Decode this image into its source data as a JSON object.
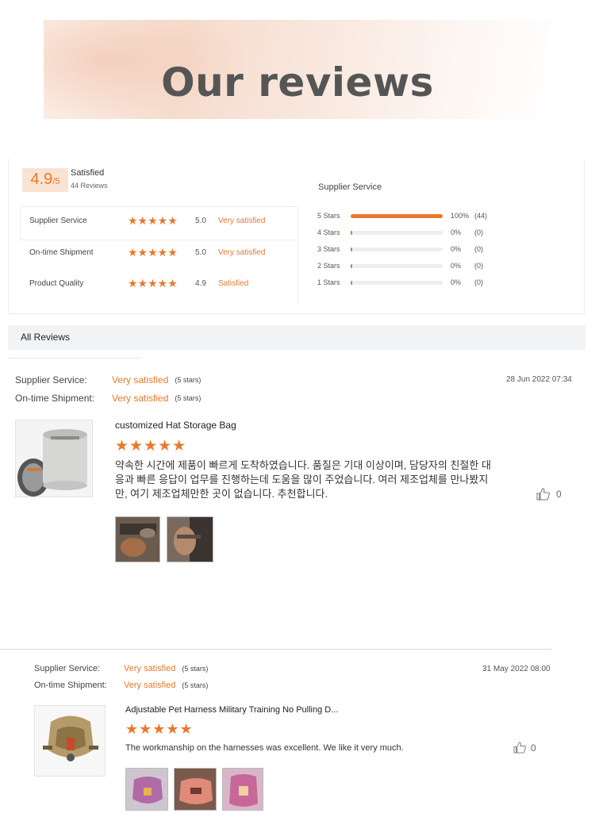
{
  "banner": {
    "title": "Our reviews"
  },
  "summary": {
    "score": "4.9",
    "score_denominator": "/5",
    "label": "Satisfied",
    "review_count": "44 Reviews",
    "ratings": [
      {
        "label": "Supplier Service",
        "stars": 5,
        "stars_text": "★★★★★",
        "value": "5.0",
        "desc": "Very satisfied"
      },
      {
        "label": "On-time Shipment",
        "stars": 5,
        "stars_text": "★★★★★",
        "value": "5.0",
        "desc": "Very satisfied"
      },
      {
        "label": "Product Quality",
        "stars": 5,
        "stars_text": "★★★★★",
        "value": "4.9",
        "desc": "Satisfied"
      }
    ],
    "breakdown_title": "Supplier Service",
    "breakdown": [
      {
        "label": "5 Stars",
        "fraction": 1.0,
        "percent": "100%",
        "count": "(44)"
      },
      {
        "label": "4 Stars",
        "fraction": 0.0,
        "percent": "0%",
        "count": "(0)"
      },
      {
        "label": "3 Stars",
        "fraction": 0.0,
        "percent": "0%",
        "count": "(0)"
      },
      {
        "label": "2 Stars",
        "fraction": 0.0,
        "percent": "0%",
        "count": "(0)"
      },
      {
        "label": "1 Stars",
        "fraction": 0.0,
        "percent": "0%",
        "count": "(0)"
      }
    ]
  },
  "reviews_header": "All Reviews",
  "reviews": [
    {
      "supplier_label": "Supplier Service:",
      "supplier_value": "Very satisfied",
      "supplier_note": "(5 stars)",
      "shipment_label": "On-time Shipment:",
      "shipment_value": "Very satisfied",
      "shipment_note": "(5 stars)",
      "date": "28 Jun 2022 07:34",
      "product": "customized Hat Storage Bag",
      "stars_text": "★★★★★",
      "text": "약속한 시간에 제품이 빠르게 도착하였습니다. 품질은 기대 이상이며, 담당자의 친절한 대응과 빠른 응답이 업무를 진행하는데 도움을 많이 주었습니다. 여러 제조업체를 만나봤지만, 여기 제조업체만한 곳이 없습니다. 추천합니다.",
      "likes": "0"
    },
    {
      "supplier_label": "Supplier Service:",
      "supplier_value": "Very satisfied",
      "supplier_note": "(5 stars)",
      "shipment_label": "On-time Shipment:",
      "shipment_value": "Very satisfied",
      "shipment_note": "(5 stars)",
      "date": "31 May 2022 08:00",
      "product": "Adjustable Pet Harness Military Training No Pulling D...",
      "stars_text": "★★★★★",
      "text": "The workmanship on the harnesses was excellent. We like it very much.",
      "likes": "0"
    }
  ],
  "colors": {
    "accent": "#e8792c",
    "header_bg": "#f2f3f5",
    "score_bg": "#fbe3d3"
  }
}
